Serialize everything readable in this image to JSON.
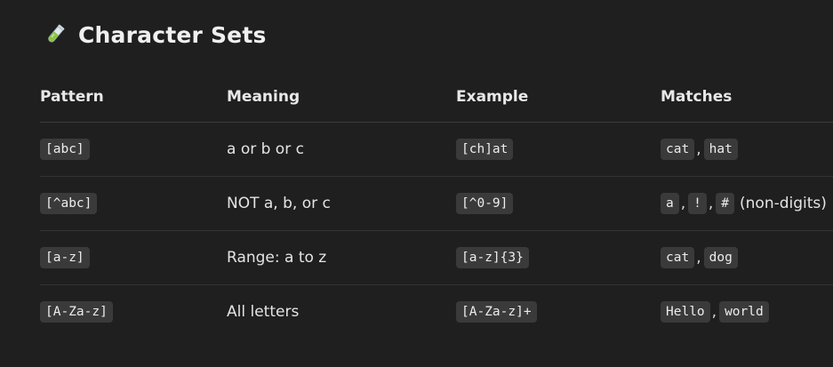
{
  "heading": {
    "icon": "test-tube-icon",
    "title": "Character Sets"
  },
  "table": {
    "headers": [
      "Pattern",
      "Meaning",
      "Example",
      "Matches"
    ],
    "rows": [
      {
        "pattern": "[abc]",
        "meaning": "a or b or c",
        "example": "[ch]at",
        "matches": [
          "cat",
          "hat"
        ],
        "note": ""
      },
      {
        "pattern": "[^abc]",
        "meaning": "NOT a, b, or c",
        "example": "[^0-9]",
        "matches": [
          "a",
          "!",
          "#"
        ],
        "note": "(non-digits)"
      },
      {
        "pattern": "[a-z]",
        "meaning": "Range: a to z",
        "example": "[a-z]{3}",
        "matches": [
          "cat",
          "dog"
        ],
        "note": ""
      },
      {
        "pattern": "[A-Za-z]",
        "meaning": "All letters",
        "example": "[A-Za-z]+",
        "matches": [
          "Hello",
          "world"
        ],
        "note": ""
      }
    ]
  },
  "colors": {
    "background": "#1f1f1f",
    "code_background": "#3a3a3a",
    "text": "#e6e6e6",
    "divider": "#3a3a3a"
  }
}
